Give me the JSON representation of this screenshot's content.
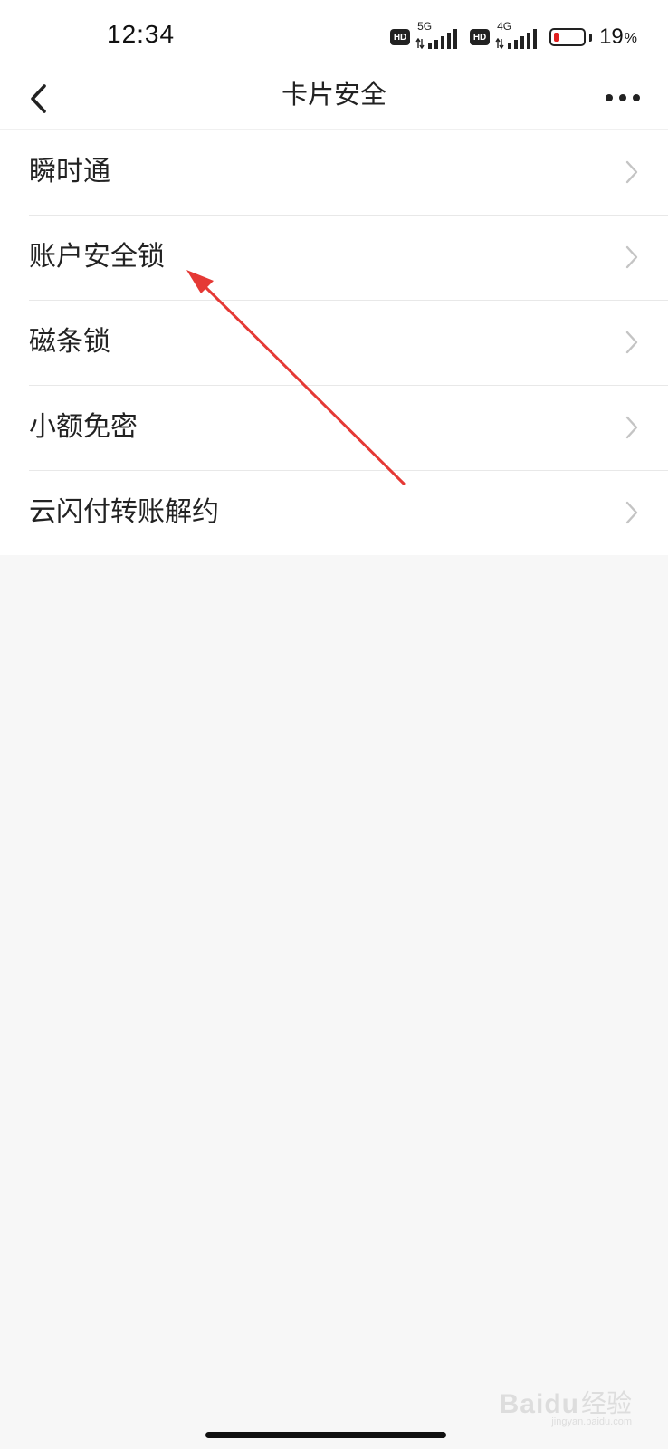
{
  "status_bar": {
    "time": "12:34",
    "network_1": "5G",
    "network_2": "4G",
    "hd_label": "HD",
    "battery_percent": "19",
    "battery_percent_sign": "%",
    "battery_level": 0.19,
    "battery_color": "#e02020"
  },
  "nav": {
    "back_icon": "chevron-left-icon",
    "title": "卡片安全",
    "more_icon": "more-dots-icon"
  },
  "menu": {
    "items": [
      {
        "label": "瞬时通"
      },
      {
        "label": "账户安全锁"
      },
      {
        "label": "磁条锁"
      },
      {
        "label": "小额免密"
      },
      {
        "label": "云闪付转账解约"
      }
    ],
    "chevron_icon": "chevron-right-icon"
  },
  "annotation": {
    "color": "#e53935",
    "points_to": "账户安全锁"
  },
  "watermark": {
    "brand": "Bai",
    "brand_suffix": "du",
    "product": "经验",
    "url": "jingyan.baidu.com"
  },
  "colors": {
    "background": "#f7f7f7",
    "surface": "#ffffff",
    "divider": "#e8e8e8",
    "text_primary": "#222222",
    "chevron": "#c4c4c4"
  }
}
